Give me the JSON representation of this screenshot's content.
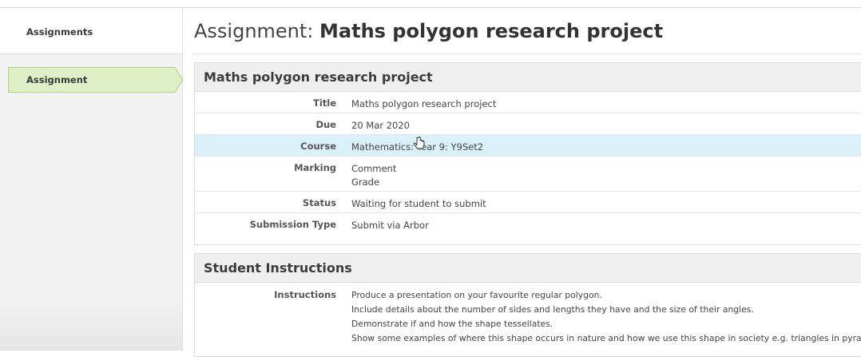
{
  "sidebar": {
    "items": [
      {
        "label": "Assignments"
      },
      {
        "label": "Assignment"
      }
    ],
    "active_color": "#dff0c8",
    "active_border": "#a9d47a"
  },
  "page": {
    "title_prefix": "Assignment: ",
    "title_name": "Maths polygon research project"
  },
  "details": {
    "heading": "Maths polygon research project",
    "rows": [
      {
        "label": "Title",
        "value": "Maths polygon research project"
      },
      {
        "label": "Due",
        "value": "20 Mar 2020"
      },
      {
        "label": "Course",
        "value": "Mathematics: Year 9: Y9Set2"
      },
      {
        "label": "Marking",
        "value": "Comment",
        "value2": "Grade"
      },
      {
        "label": "Status",
        "value": "Waiting for student to submit"
      },
      {
        "label": "Submission Type",
        "value": "Submit via Arbor"
      }
    ]
  },
  "instructions": {
    "heading": "Student Instructions",
    "label": "Instructions",
    "lines": [
      "Produce a presentation on your favourite regular polygon.",
      "Include details about the number of sides and lengths they have and the size of their angles.",
      "Demonstrate if and how the shape tessellates.",
      "Show some examples of where this shape occurs in nature and how we use this shape in society e.g. triangles in pyramid"
    ]
  },
  "colors": {
    "highlight_row": "#daf1f9",
    "panel_header": "#efefef"
  }
}
